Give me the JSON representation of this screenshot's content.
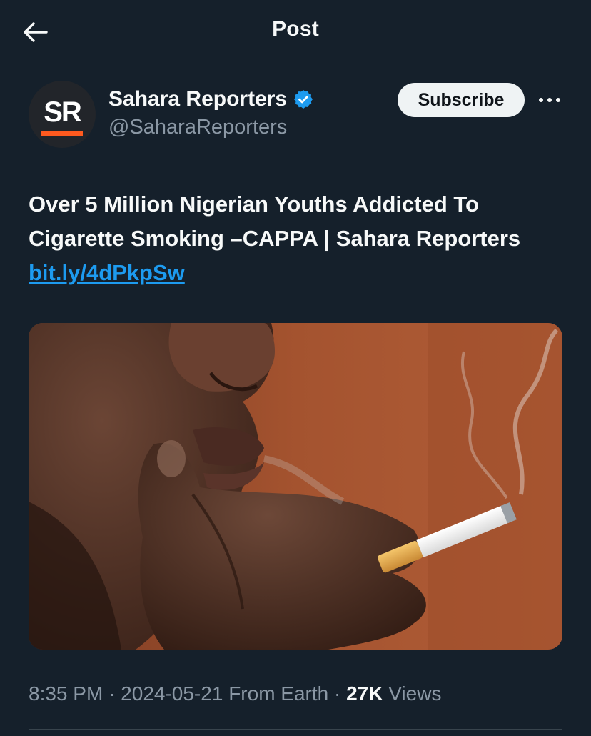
{
  "header": {
    "title": "Post",
    "back_icon": "arrow-left-icon"
  },
  "author": {
    "avatar_text": "SR",
    "avatar_accent": "#ff5a1f",
    "name": "Sahara Reporters",
    "verified_icon": "verified-badge-icon",
    "verified_color": "#1d9bf0",
    "handle": "@SaharaReporters",
    "subscribe_label": "Subscribe",
    "more_icon": "more-horizontal-icon"
  },
  "post": {
    "text": "Over 5 Million Nigerian Youths Addicted To Cigarette Smoking –CAPPA | Sahara Reporters",
    "link": "bit.ly/4dPkpSw",
    "link_color": "#1d9bf0"
  },
  "meta": {
    "time": "8:35 PM",
    "separator": "·",
    "date": "2024-05-21",
    "source": "From Earth",
    "views_count": "27K",
    "views_label": "Views"
  },
  "theme": {
    "background": "#15202b",
    "text_primary": "#f7f9f9",
    "text_secondary": "#8b98a5"
  }
}
